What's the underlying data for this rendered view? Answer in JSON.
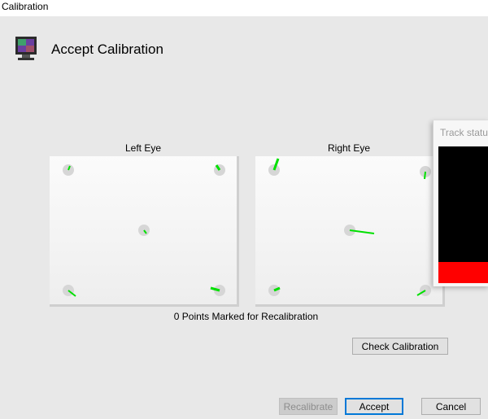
{
  "window": {
    "title": "Calibration"
  },
  "header": {
    "title": "Accept Calibration",
    "icon": "monitor-icon"
  },
  "left_eye": {
    "label": "Left Eye"
  },
  "right_eye": {
    "label": "Right Eye"
  },
  "status": {
    "points_marked": "0 Points Marked for Recalibration"
  },
  "buttons": {
    "check_calibration": "Check Calibration",
    "recalibrate": "Recalibrate",
    "accept": "Accept",
    "cancel": "Cancel"
  },
  "track_status": {
    "title": "Track status"
  },
  "colors": {
    "gaze_error": "#00e000",
    "target": "#d6d6d6",
    "track_bad": "#ff0000"
  }
}
